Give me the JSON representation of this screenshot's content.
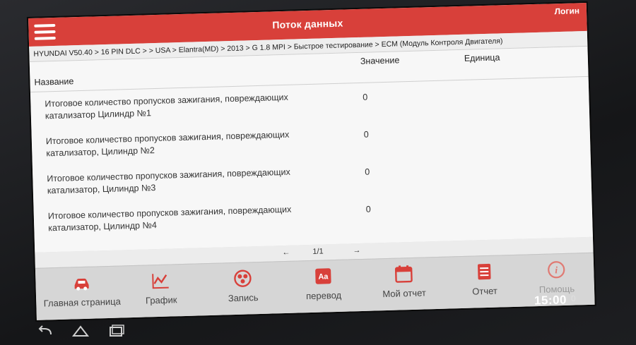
{
  "header": {
    "title": "Поток данных",
    "login": "Логин"
  },
  "breadcrumb": "HYUNDAI V50.40 > 16 PIN DLC > > USA > Elantra(MD) > 2013 > G 1.8 MPI > Быстрое тестирование > ECM (Модуль Контроля Двигателя)",
  "table": {
    "columns": {
      "name": "Название",
      "value": "Значение",
      "unit": "Единица"
    },
    "rows": [
      {
        "name_line1": "Итоговое количество пропусков зажигания, повреждающих",
        "name_line2": "катализатор Цилиндр №1",
        "value": "0",
        "unit": ""
      },
      {
        "name_line1": "Итоговое количество пропусков зажигания, повреждающих",
        "name_line2": "катализатор, Цилиндр №2",
        "value": "0",
        "unit": ""
      },
      {
        "name_line1": "Итоговое количество пропусков зажигания, повреждающих",
        "name_line2": "катализатор, Цилиндр №3",
        "value": "0",
        "unit": ""
      },
      {
        "name_line1": "Итоговое количество пропусков зажигания, повреждающих",
        "name_line2": "катализатор, Цилиндр №4",
        "value": "0",
        "unit": ""
      }
    ]
  },
  "pager": {
    "prev": "←",
    "page": "1/1",
    "next": "→"
  },
  "toolbar": {
    "home": "Главная страница",
    "graph": "График",
    "record": "Запись",
    "translate": "перевод",
    "my_report": "Мой отчет",
    "report": "Отчет",
    "help": "Помощь"
  },
  "status": {
    "time": "15:00",
    "extra": "0"
  },
  "colors": {
    "accent": "#d8403a",
    "icon": "#d8403a"
  }
}
